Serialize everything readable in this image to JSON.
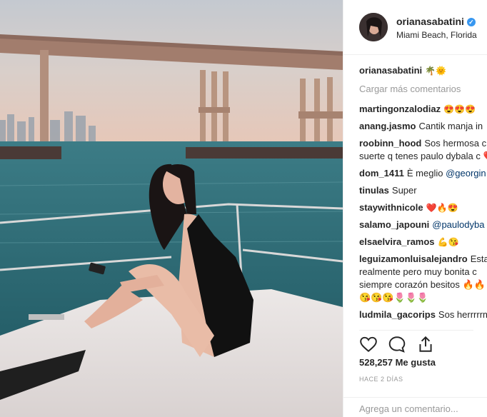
{
  "post": {
    "username": "orianasabatini",
    "location": "Miami Beach, Florida",
    "caption_user": "orianasabatini",
    "caption_text": "🌴🌞"
  },
  "comments": {
    "load_more": "Cargar más comentarios",
    "items": [
      {
        "user": "martingonzalodiaz",
        "text": "😍😍😍"
      },
      {
        "user": "anang.jasmo",
        "text": "Cantik manja in"
      },
      {
        "user": "roobinn_hood",
        "text": "Sos hermosa c suerte q tenes paulo dybala c ❤️"
      },
      {
        "user": "dom_1411",
        "text": "È meglio ",
        "mention": "@georgin"
      },
      {
        "user": "tinulas",
        "text": "Super"
      },
      {
        "user": "staywithnicole",
        "text": "❤️🔥😍"
      },
      {
        "user": "salamo_japouni",
        "text": "",
        "mention": "@paulodyba"
      },
      {
        "user": "elsaelvira_ramos",
        "text": "💪😘"
      },
      {
        "user": "leguizamonluisalejandro",
        "text": "Esta realmente pero muy bonita c siempre corazón besitos 🔥🔥 😘😘😘🌷🌷🌷"
      },
      {
        "user": "ludmila_gacorips",
        "text": "Sos herrrrrm"
      }
    ]
  },
  "likes": "528,257 Me gusta",
  "timestamp": "HACE 2 DÍAS",
  "add_comment_placeholder": "Agrega un comentario..."
}
